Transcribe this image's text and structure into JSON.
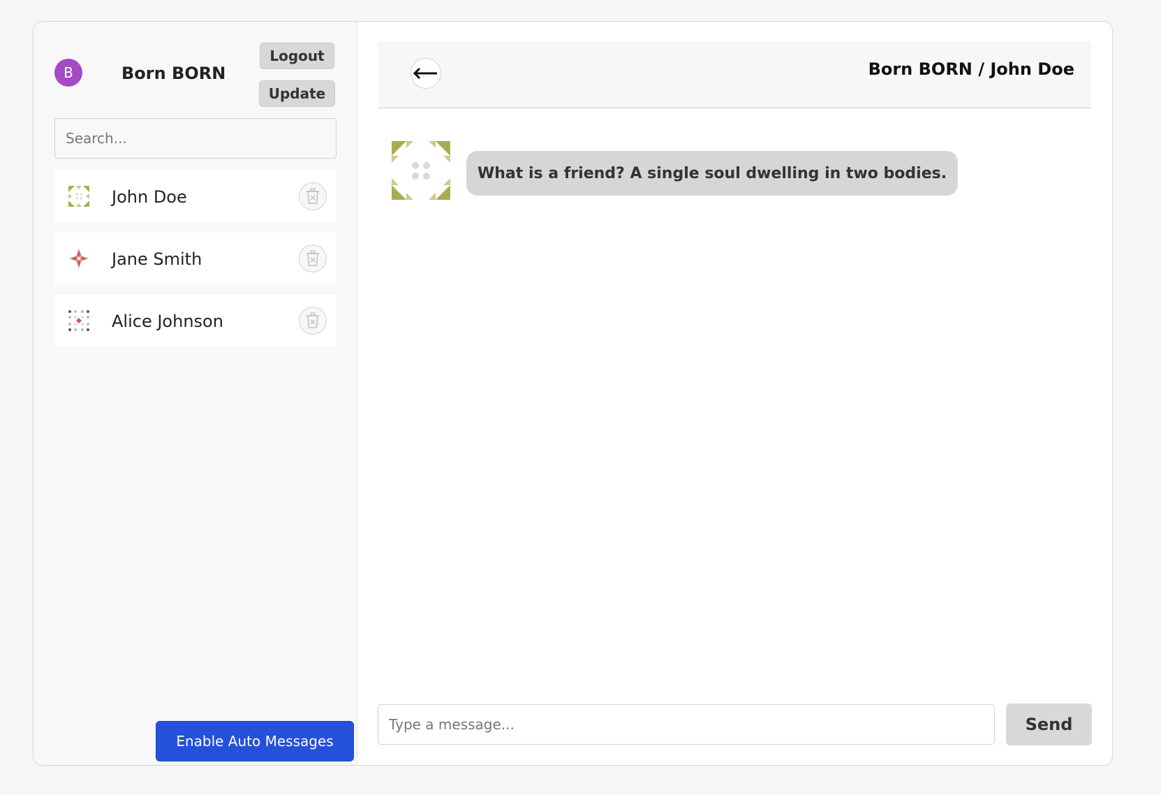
{
  "user": {
    "initial": "B",
    "name": "Born BORN",
    "avatar_color": "#a24bc4"
  },
  "actions": {
    "logout": "Logout",
    "update": "Update"
  },
  "search": {
    "placeholder": "Search..."
  },
  "contacts": [
    {
      "name": "John Doe",
      "avatar": "identicon-olive",
      "delete_icon": "trash-icon"
    },
    {
      "name": "Jane Smith",
      "avatar": "identicon-red",
      "delete_icon": "trash-icon"
    },
    {
      "name": "Alice Johnson",
      "avatar": "identicon-dots",
      "delete_icon": "trash-icon"
    }
  ],
  "auto_messages": {
    "label": "Enable Auto Messages",
    "color": "#2450db"
  },
  "chat": {
    "title": "Born BORN / John Doe",
    "back_icon": "arrow-left-icon",
    "messages": [
      {
        "text": "What is a friend? A single soul dwelling in two bodies.",
        "avatar": "identicon-olive"
      }
    ],
    "input_placeholder": "Type a message...",
    "send_label": "Send"
  }
}
